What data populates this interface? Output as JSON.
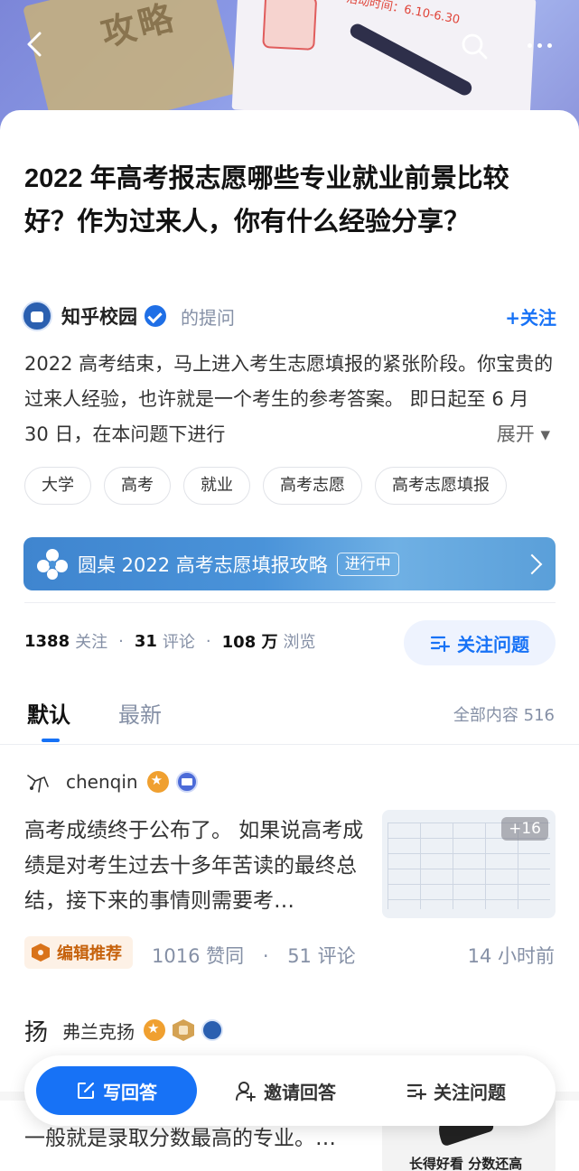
{
  "banner": {
    "stamp_text": "活动时间：6.10-6.30",
    "book_text": "攻略"
  },
  "question": {
    "title": "2022 年高考报志愿哪些专业就业前景比较好？作为过来人，你有什么经验分享？",
    "asker_name": "知乎校园",
    "asker_role": "的提问",
    "follow_label": "+关注",
    "description": "2022 高考结束，马上进入考生志愿填报的紧张阶段。你宝贵的过来人经验，也许就是一个考生的参考答案。 即日起至 6 月 30 日，在本问题下进行",
    "expand_label": "展开 ▾"
  },
  "tags": [
    "大学",
    "高考",
    "就业",
    "高考志愿",
    "高考志愿填报"
  ],
  "roundtable": {
    "title": "圆桌 2022 高考志愿填报攻略",
    "status": "进行中"
  },
  "stats": {
    "followers": "1388",
    "followers_label": "关注",
    "comments": "31",
    "comments_label": "评论",
    "views": "108 万",
    "views_label": "浏览",
    "separator": "·",
    "follow_question_label": "关注问题"
  },
  "tabs": {
    "default": "默认",
    "newest": "最新",
    "total": "全部内容 516"
  },
  "answers": [
    {
      "author": "chenqin",
      "excerpt": "高考成绩终于公布了。 如果说高考成绩是对考生过去十多年苦读的最终总结，接下来的事情则需要考…",
      "image_count": "+16",
      "editor_pick": "编辑推荐",
      "likes": "1016 赞同",
      "comments": "51 评论",
      "time": "14 小时前"
    },
    {
      "author": "弗兰克扬",
      "avatar_char": "扬",
      "excerpt": "一般就是录取分数最高的专业。…",
      "image_caption": "长得好看   分数还高"
    }
  ],
  "action_bar": {
    "write": "写回答",
    "invite": "邀请回答",
    "follow": "关注问题"
  },
  "colors": {
    "accent": "#1772f6",
    "muted": "#8590a6",
    "editor_pick": "#c6620c"
  }
}
